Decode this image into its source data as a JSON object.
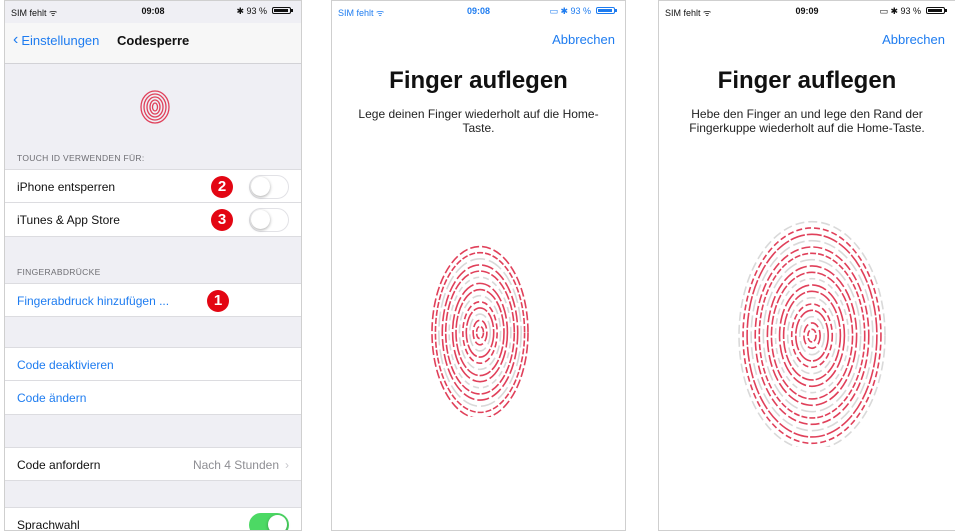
{
  "panel1": {
    "status": {
      "carrier": "SIM fehlt ᯤ",
      "time": "09:08",
      "battery": "✱ 93 %"
    },
    "nav": {
      "back_label": "Einstellungen",
      "title": "Codesperre"
    },
    "section_touchid": "TOUCH ID VERWENDEN FÜR:",
    "rows_touchid": [
      {
        "label": "iPhone entsperren",
        "badge": "2",
        "toggle": false
      },
      {
        "label": "iTunes & App Store",
        "badge": "3",
        "toggle": false
      }
    ],
    "section_fingerprints": "FINGERABDRÜCKE",
    "add_fingerprint": {
      "label": "Fingerabdruck hinzufügen ...",
      "badge": "1"
    },
    "code_deactivate": "Code deaktivieren",
    "code_change": "Code ändern",
    "code_require": {
      "label": "Code anfordern",
      "value": "Nach 4 Stunden"
    },
    "voice_dial": {
      "label": "Sprachwahl",
      "toggle": true
    }
  },
  "panel2": {
    "status": {
      "carrier": "SIM fehlt ᯤ",
      "time": "09:08",
      "battery": "▭ ✱ 93 %"
    },
    "cancel": "Abbrechen",
    "title": "Finger auflegen",
    "subtitle": "Lege deinen Finger wiederholt auf die Home-Taste."
  },
  "panel3": {
    "status": {
      "carrier": "SIM fehlt ᯤ",
      "time": "09:09",
      "battery": "▭ ✱ 93 %"
    },
    "cancel": "Abbrechen",
    "title": "Finger auflegen",
    "subtitle": "Hebe den Finger an und lege den Rand der Fingerkuppe wiederholt auf die Home-Taste."
  },
  "colors": {
    "accent": "#1e7cf0",
    "badge": "#e30613",
    "fingerprint": "#e0405a",
    "toggle_on": "#4cd964"
  }
}
